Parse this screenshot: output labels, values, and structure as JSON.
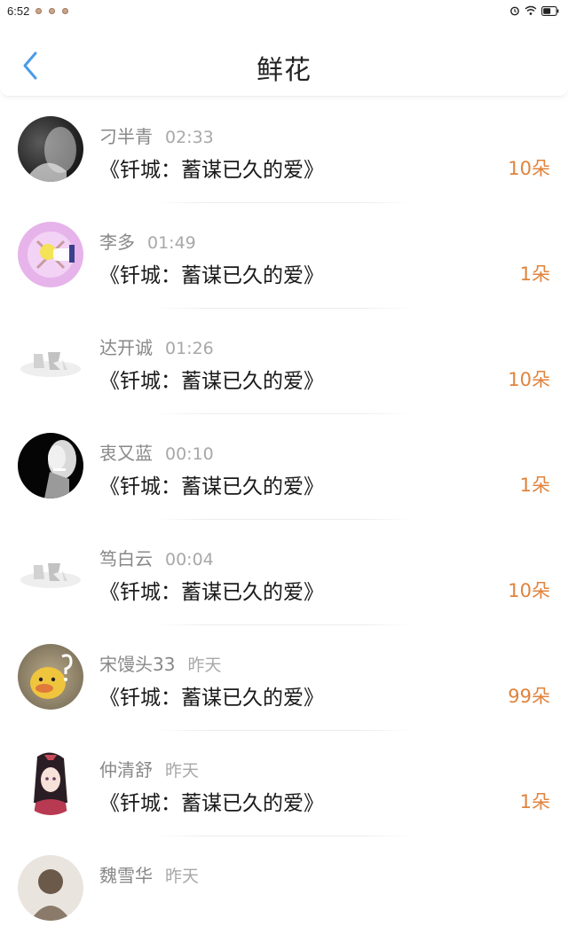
{
  "status": {
    "time": "6:52"
  },
  "header": {
    "title": "鲜花"
  },
  "records": [
    {
      "name": "刁半青",
      "time": "02:33",
      "book": "《钎城：蓄谋已久的爱》",
      "count": "10朵"
    },
    {
      "name": "李多",
      "time": "01:49",
      "book": "《钎城：蓄谋已久的爱》",
      "count": "1朵"
    },
    {
      "name": "达开诚",
      "time": "01:26",
      "book": "《钎城：蓄谋已久的爱》",
      "count": "10朵"
    },
    {
      "name": "衷又蓝",
      "time": "00:10",
      "book": "《钎城：蓄谋已久的爱》",
      "count": "1朵"
    },
    {
      "name": "笃白云",
      "time": "00:04",
      "book": "《钎城：蓄谋已久的爱》",
      "count": "10朵"
    },
    {
      "name": "宋馒头33",
      "time": "昨天",
      "book": "《钎城：蓄谋已久的爱》",
      "count": "99朵"
    },
    {
      "name": "仲清舒",
      "time": "昨天",
      "book": "《钎城：蓄谋已久的爱》",
      "count": "1朵"
    },
    {
      "name": "魏雪华",
      "time": "昨天",
      "book": "",
      "count": ""
    }
  ],
  "colors": {
    "accent": "#e0833d",
    "back_arrow": "#4a9be8"
  }
}
